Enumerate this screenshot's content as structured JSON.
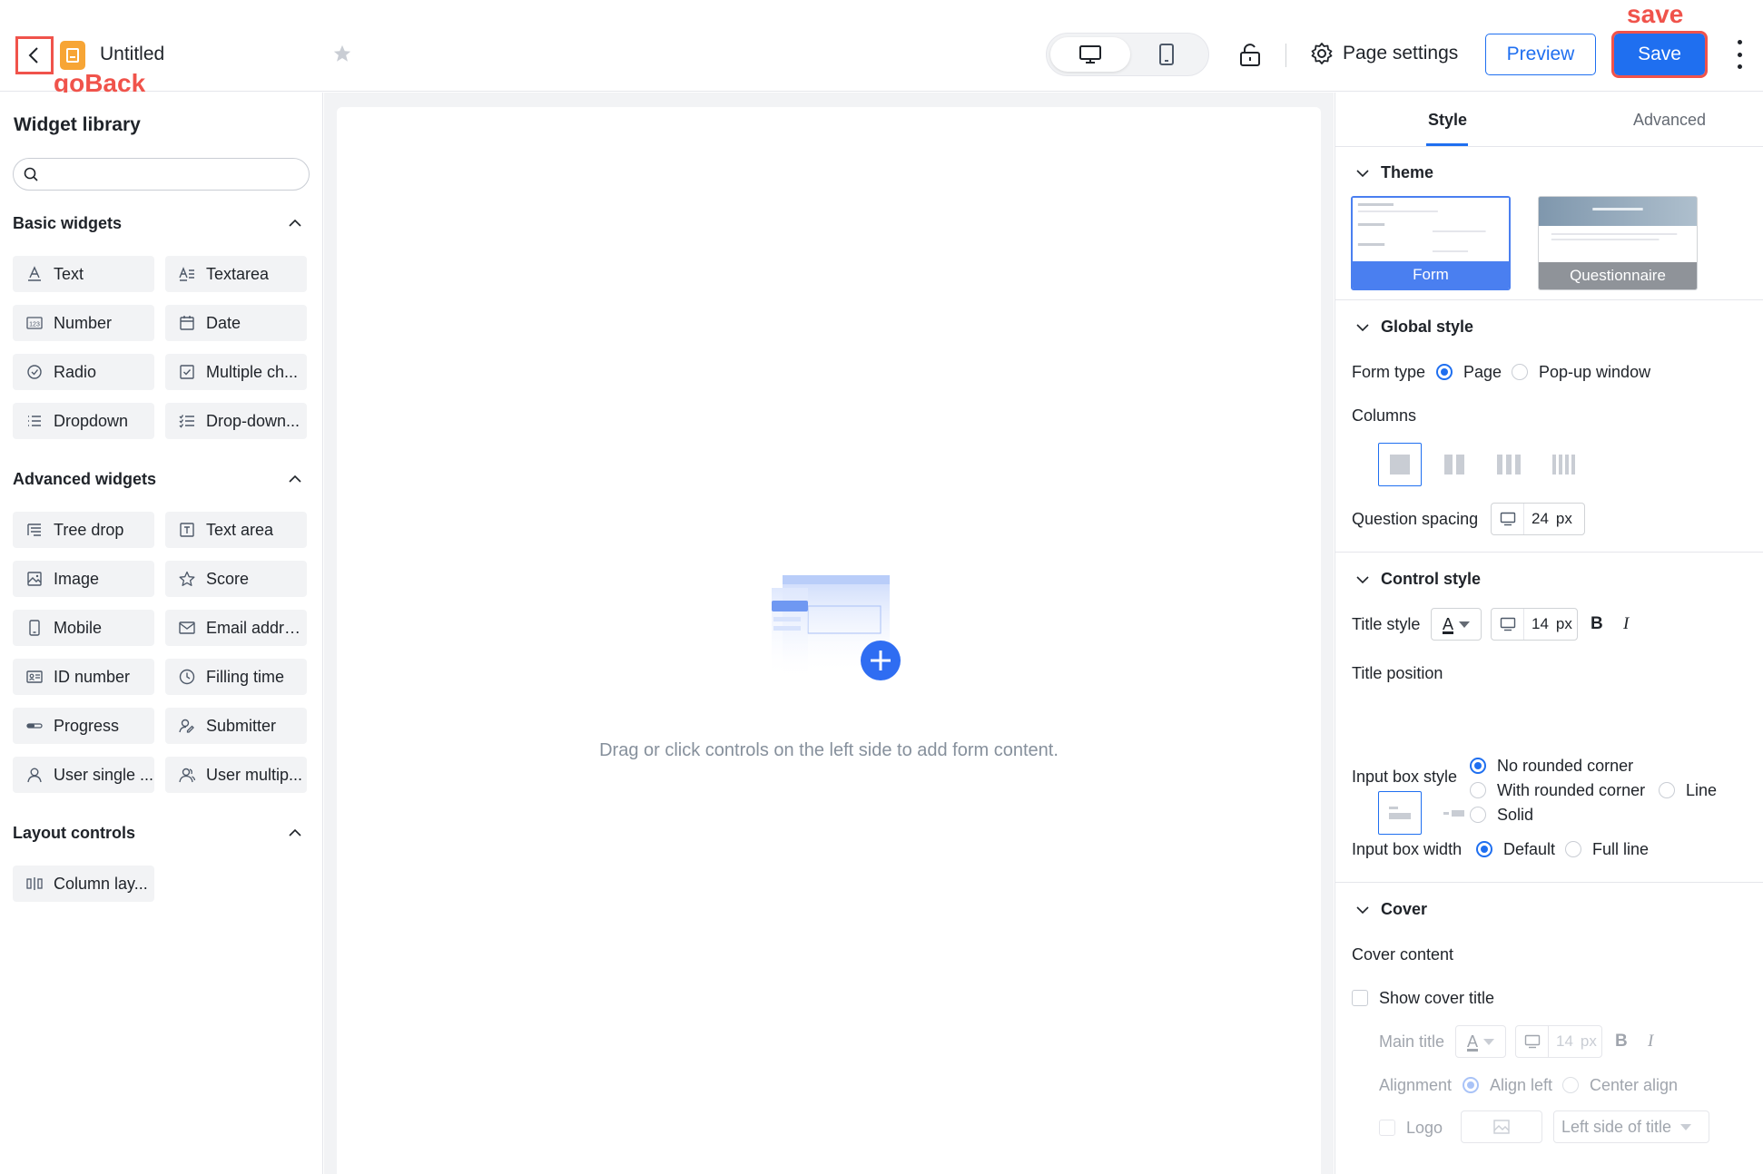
{
  "header": {
    "doc_title": "Untitled",
    "annotations": {
      "go_back": "goBack",
      "save": "save"
    },
    "page_settings_label": "Page settings",
    "preview_label": "Preview",
    "save_label": "Save"
  },
  "left_panel": {
    "title": "Widget library",
    "search": {
      "placeholder": "",
      "value": ""
    },
    "sections": [
      {
        "title": "Basic widgets",
        "widgets": [
          "Text",
          "Textarea",
          "Number",
          "Date",
          "Radio",
          "Multiple ch...",
          "Dropdown",
          "Drop-down..."
        ]
      },
      {
        "title": "Advanced widgets",
        "widgets": [
          "Tree drop",
          "Text area",
          "Image",
          "Score",
          "Mobile",
          "Email addre...",
          "ID number",
          "Filling time",
          "Progress",
          "Submitter",
          "User single ...",
          "User multip..."
        ]
      },
      {
        "title": "Layout controls",
        "widgets": [
          "Column lay..."
        ]
      }
    ]
  },
  "canvas": {
    "empty_text": "Drag or click controls on the left side to add form content."
  },
  "right_panel": {
    "tabs": [
      "Style",
      "Advanced"
    ],
    "theme": {
      "title": "Theme",
      "options": [
        "Form",
        "Questionnaire"
      ],
      "selected": "Form"
    },
    "global_style": {
      "title": "Global style",
      "form_type_label": "Form type",
      "form_type_options": [
        "Page",
        "Pop-up window"
      ],
      "columns_label": "Columns",
      "question_spacing_label": "Question spacing",
      "question_spacing_value": "24",
      "unit": "px"
    },
    "control_style": {
      "title": "Control style",
      "title_style_label": "Title style",
      "font_letter": "A",
      "font_size_value": "14",
      "unit": "px",
      "bold": "B",
      "italic": "I",
      "title_position_label": "Title position",
      "input_box_style_label": "Input box style",
      "input_box_style_options": [
        "No rounded corner",
        "With rounded corner",
        "Line",
        "Solid"
      ],
      "input_box_width_label": "Input box width",
      "input_box_width_options": [
        "Default",
        "Full line"
      ]
    },
    "cover": {
      "title": "Cover",
      "cover_content_label": "Cover content",
      "show_cover_title_label": "Show cover title",
      "main_title_label": "Main title",
      "main_title_size": "14",
      "unit": "px",
      "alignment_label": "Alignment",
      "alignment_options": [
        "Align left",
        "Center align"
      ],
      "logo_label": "Logo",
      "logo_position": "Left side of title"
    }
  },
  "colors": {
    "accent": "#1f6ff0",
    "annotation": "#f0534b",
    "logo": "#f7a535"
  }
}
